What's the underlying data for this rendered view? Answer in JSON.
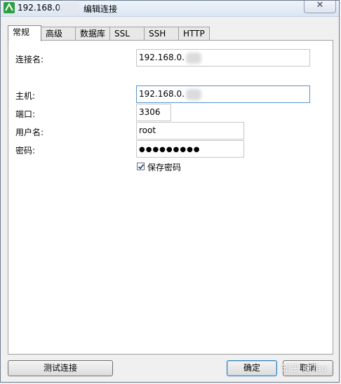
{
  "window": {
    "title_ip": "192.168.0.",
    "title_text": "编辑连接",
    "close_label": "✕"
  },
  "tabs": [
    {
      "label": "常规",
      "active": true
    },
    {
      "label": "高级"
    },
    {
      "label": "数据库"
    },
    {
      "label": "SSL"
    },
    {
      "label": "SSH"
    },
    {
      "label": "HTTP"
    }
  ],
  "form": {
    "connection_name_label": "连接名:",
    "connection_name_value": "192.168.0.",
    "host_label": "主机:",
    "host_value": "192.168.0.",
    "port_label": "端口:",
    "port_value": "3306",
    "username_label": "用户名:",
    "username_value": "root",
    "password_label": "密码:",
    "password_value": "●●●●●●●●●",
    "save_password_label": "保存密码",
    "save_password_checked": true
  },
  "buttons": {
    "test_connection": "测试连接",
    "ok": "确定",
    "cancel": "取消"
  },
  "watermark": "知乎 @Tao"
}
